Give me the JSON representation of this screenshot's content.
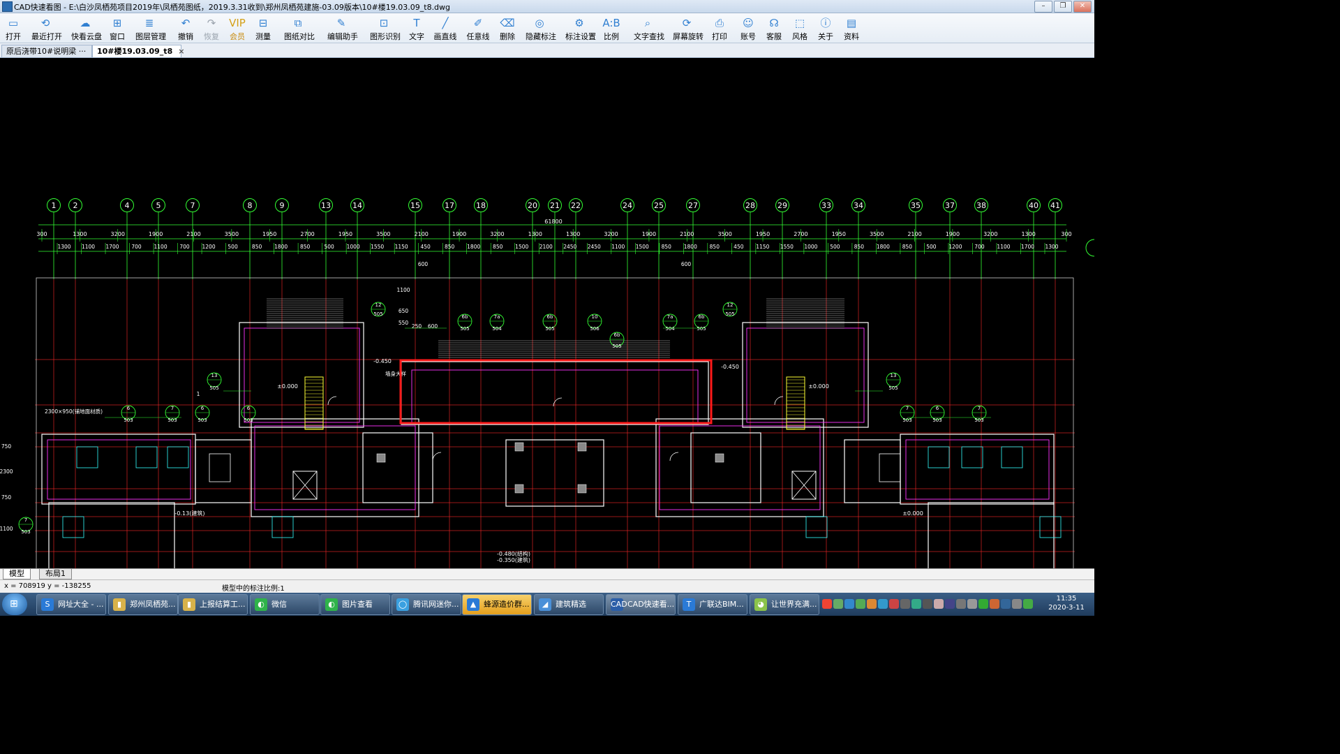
{
  "window": {
    "title": "CAD快速看图 - E:\\白沙凤栖苑项目2019年\\凤栖苑图纸，2019.3.31收到\\郑州凤栖苑建施-03.09版本\\10#楼19.03.09_t8.dwg",
    "buttons": [
      "–",
      "❐",
      "✕"
    ]
  },
  "toolbar": [
    {
      "label": "打开",
      "icon": "▭"
    },
    {
      "label": "最近打开",
      "icon": "⟲"
    },
    {
      "label": "快看云盘",
      "icon": "☁"
    },
    {
      "label": "窗口",
      "icon": "⊞"
    },
    {
      "label": "图层管理",
      "icon": "≣"
    },
    {
      "label": "撤销",
      "icon": "↶"
    },
    {
      "label": "恢复",
      "icon": "↷",
      "disabled": true
    },
    {
      "label": "会员",
      "icon": "VIP",
      "vip": true
    },
    {
      "label": "测量",
      "icon": "⊟"
    },
    {
      "label": "图纸对比",
      "icon": "⧉"
    },
    {
      "label": "编辑助手",
      "icon": "✎"
    },
    {
      "label": "图形识别",
      "icon": "⊡"
    },
    {
      "label": "文字",
      "icon": "T"
    },
    {
      "label": "画直线",
      "icon": "╱"
    },
    {
      "label": "任意线",
      "icon": "✐"
    },
    {
      "label": "删除",
      "icon": "⌫"
    },
    {
      "label": "隐藏标注",
      "icon": "◎"
    },
    {
      "label": "标注设置",
      "icon": "⚙"
    },
    {
      "label": "比例",
      "icon": "A:B"
    },
    {
      "label": "文字查找",
      "icon": "⌕"
    },
    {
      "label": "屏幕旋转",
      "icon": "⟳"
    },
    {
      "label": "打印",
      "icon": "⎙"
    },
    {
      "label": "账号",
      "icon": "☺"
    },
    {
      "label": "客服",
      "icon": "☊"
    },
    {
      "label": "风格",
      "icon": "⬚"
    },
    {
      "label": "关于",
      "icon": "ⓘ"
    },
    {
      "label": "资料",
      "icon": "▤"
    }
  ],
  "tabs": [
    {
      "label": "原后浇带10#说明梁 ···",
      "close": "×"
    },
    {
      "label": "10#楼19.03.09_t8",
      "close": "×",
      "active": true
    }
  ],
  "drawing": {
    "axes_top": [
      "1",
      "2",
      "4",
      "5",
      "7",
      "8",
      "9",
      "13",
      "14",
      "15",
      "17",
      "18",
      "20",
      "21",
      "22",
      "24",
      "25",
      "27",
      "28",
      "29",
      "33",
      "34",
      "35",
      "37",
      "38",
      "40",
      "41"
    ],
    "overall_dim": "61800",
    "dims_row1": [
      "300",
      "1300",
      "3200",
      "1900",
      "2100",
      "3500",
      "1950",
      "2700",
      "1950",
      "3500",
      "2100",
      "1900",
      "3200",
      "1300",
      "1300",
      "3200",
      "1900",
      "2100",
      "3500",
      "1950",
      "2700",
      "1950",
      "3500",
      "2100",
      "1900",
      "3200",
      "1300",
      "300"
    ],
    "dims_row2": [
      "1300",
      "1100",
      "1700",
      "700",
      "1100",
      "700",
      "1200",
      "500",
      "850",
      "1800",
      "850",
      "500",
      "1000",
      "1550",
      "1150",
      "450",
      "850",
      "1800",
      "850",
      "1500",
      "2100",
      "2450",
      "2450",
      "1100",
      "1500",
      "850",
      "1800",
      "850",
      "450",
      "1150",
      "1550",
      "1000",
      "500",
      "850",
      "1800",
      "850",
      "500",
      "1200",
      "700",
      "1100",
      "1700",
      "1300"
    ],
    "level_labels": [
      "-0.450",
      "±0.000",
      "-0.450",
      "±0.000",
      "±0.000",
      "-0.13(建筑)",
      "-0.480(结构)",
      "-0.350(建筑)"
    ],
    "callouts": [
      "12",
      "505",
      "6b",
      "505",
      "7a",
      "504",
      "6b",
      "505",
      "10",
      "506",
      "6b",
      "505",
      "7a",
      "504",
      "6b",
      "505",
      "12",
      "505",
      "13",
      "505",
      "13",
      "505",
      "6",
      "503",
      "7",
      "503",
      "6",
      "503",
      "6",
      "503",
      "7",
      "503",
      "6",
      "503",
      "7",
      "503",
      "7",
      "503"
    ],
    "misc_text": [
      "600",
      "600",
      "1100",
      "650",
      "550",
      "250",
      "600",
      "2300×950(铺地面材质)",
      "1",
      "750",
      "2300",
      "750",
      "1100",
      "墙身大样"
    ]
  },
  "layout_tabs": [
    "模型",
    "布局1"
  ],
  "status": {
    "coords": "x = 708919  y = -138255",
    "scale": "模型中的标注比例:1"
  },
  "taskbar": {
    "items": [
      {
        "label": "网址大全 - ...",
        "icon": "S",
        "color": "#2a7ad6"
      },
      {
        "label": "郑州凤栖苑...",
        "icon": "▮",
        "color": "#d8b24a"
      },
      {
        "label": "上报结算工...",
        "icon": "▮",
        "color": "#d8b24a"
      },
      {
        "label": "微信",
        "icon": "◐",
        "color": "#2fb34a"
      },
      {
        "label": "图片查看",
        "icon": "◐",
        "color": "#2fb34a"
      },
      {
        "label": "腾讯网迷你...",
        "icon": "◯",
        "color": "#3aa0e0"
      },
      {
        "label": "蜂源造价群...",
        "icon": "▲",
        "color": "#2a7ad6",
        "highlight": true
      },
      {
        "label": "建筑精选",
        "icon": "◢",
        "color": "#4a90d8"
      },
      {
        "label": "CAD快速看...",
        "icon": "CAD",
        "color": "#2b5ea8",
        "active": true
      },
      {
        "label": "广联达BIM...",
        "icon": "T",
        "color": "#2a7ad6"
      },
      {
        "label": "让世界充满...",
        "icon": "◕",
        "color": "#8bc34a"
      }
    ],
    "clock_time": "11:35",
    "clock_date": "2020-3-11"
  }
}
